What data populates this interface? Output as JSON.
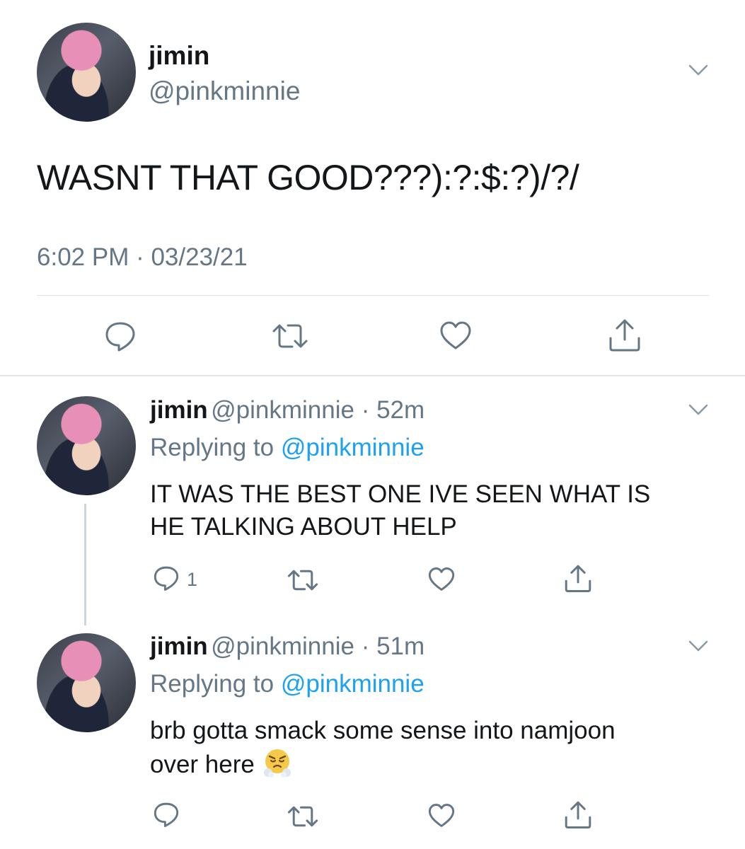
{
  "colors": {
    "accent": "#1da1f2",
    "muted": "#657786",
    "text": "#14171a",
    "divider": "#e1e6ea"
  },
  "main_tweet": {
    "name": "jimin",
    "handle": "@pinkminnie",
    "text": "WASNT THAT GOOD???):?:$:?)/?/",
    "timestamp": "6:02 PM · 03/23/21",
    "actions": [
      "reply-icon",
      "retweet-icon",
      "like-icon",
      "share-icon"
    ]
  },
  "replies": [
    {
      "name": "jimin",
      "meta": "@pinkminnie · 52m",
      "replying_label": "Replying to ",
      "replying_to": "@pinkminnie",
      "text_line1": "IT WAS THE BEST ONE IVE SEEN WHAT IS",
      "text_line2": "HE TALKING ABOUT HELP",
      "reply_count": "1"
    },
    {
      "name": "jimin",
      "meta": "@pinkminnie · 51m",
      "replying_label": "Replying to ",
      "replying_to": "@pinkminnie",
      "text_line1": "brb gotta smack some sense into namjoon",
      "text_line2": "over here",
      "emoji": "face-with-steam-from-nose-emoji"
    }
  ]
}
